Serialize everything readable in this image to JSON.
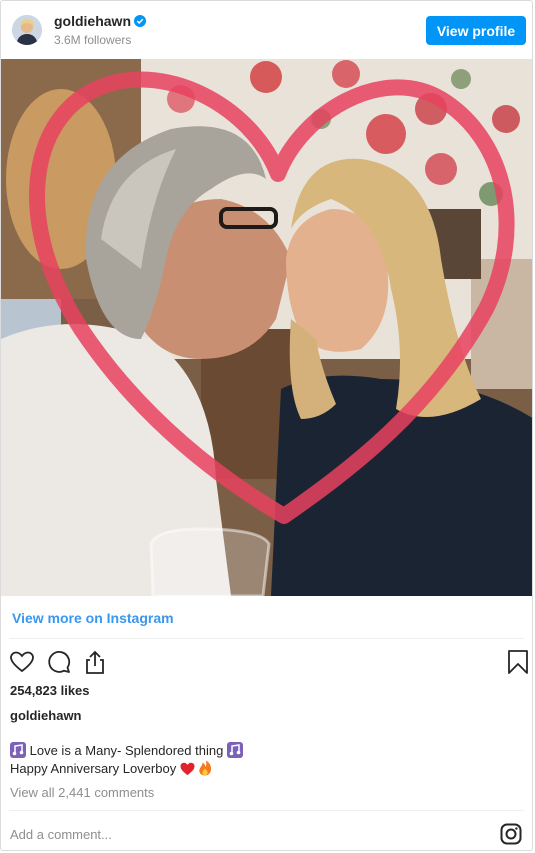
{
  "header": {
    "username": "goldiehawn",
    "followers": "3.6M followers",
    "view_profile_label": "View profile",
    "verified_color": "#0095f6"
  },
  "photo": {
    "overlay_shape": "heart-outline",
    "overlay_color": "#e8425f"
  },
  "view_more_label": "View more on Instagram",
  "actions": {
    "icons": [
      "heart-icon",
      "comment-icon",
      "share-icon",
      "bookmark-icon"
    ]
  },
  "likes": "254,823 likes",
  "caption": {
    "username": "goldiehawn",
    "line1": "Love is a Many- Splendored thing",
    "line2": "Happy Anniversary Loverboy"
  },
  "view_comments_label": "View all 2,441 comments",
  "add_comment_placeholder": "Add a comment...",
  "colors": {
    "accent": "#0095f6",
    "link": "#3897f0",
    "muted": "#8e8e8e",
    "text": "#262626"
  }
}
